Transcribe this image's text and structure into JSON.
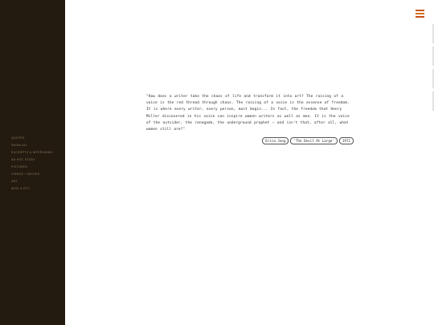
{
  "sidebar": {
    "nav_items": [
      "Quotes",
      "Show All",
      "Excerpts & Interviews",
      "Ad Hoc Study",
      "Pictures",
      "Videos + Movies",
      "Art",
      "Misc & Etc"
    ]
  },
  "header": {
    "menu_icon": "hamburger-menu-icon"
  },
  "quote": {
    "text": "\"How does a writer take the chaos of life and transform it into art? The raising of a voice is the red thread through chaos. The raising of a voice is the essense of freedom. It is where every writer, every person, must begin... In fact, the freedom that Henry Miller discovered in his voice can inspire women writers as well as men. It is the voice of the outsider, the renegade, the underground prophet — and isn't that, after all, what women still are?\"",
    "author": "Erica Jong",
    "source": "'The Devil At Large'",
    "year": "1971"
  },
  "colors": {
    "sidebar_bg": "#231a10",
    "nav_text": "#8d7b5f",
    "menu_accent": "#c8561a",
    "page_bg": "#ffffff"
  }
}
